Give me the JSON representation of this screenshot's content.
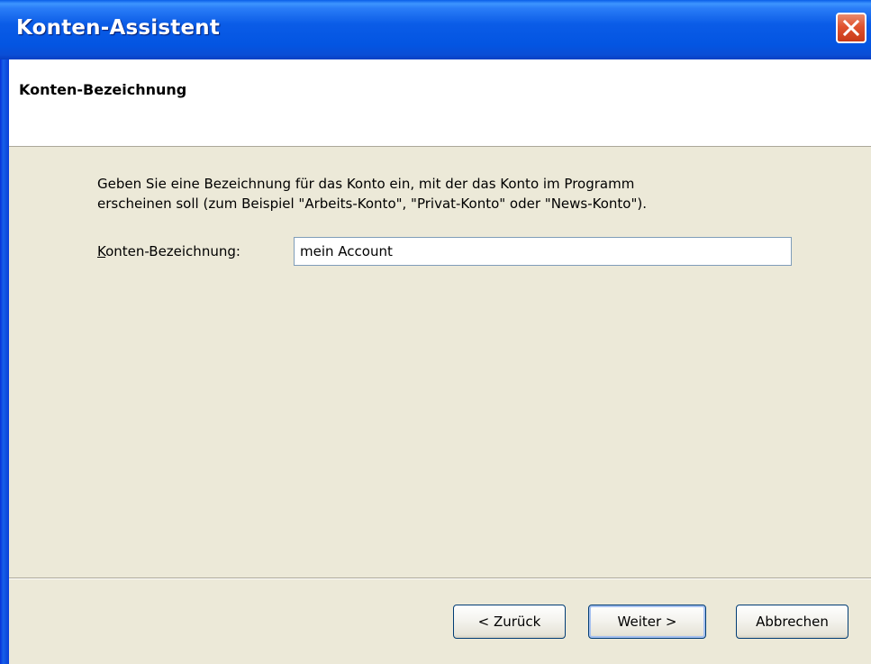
{
  "window": {
    "title": "Konten-Assistent"
  },
  "header": {
    "page_title": "Konten-Bezeichnung"
  },
  "main": {
    "description_line1": "Geben Sie eine Bezeichnung für das Konto ein, mit der das Konto im Programm",
    "description_line2": "erscheinen soll (zum Beispiel \"Arbeits-Konto\", \"Privat-Konto\" oder \"News-Konto\").",
    "field_label_accesskey": "K",
    "field_label_rest": "onten-Bezeichnung:",
    "field_value": "mein Account"
  },
  "buttons": {
    "back_label": "< Zurück",
    "next_label": "Weiter >",
    "cancel_label": "Abbrechen"
  },
  "icons": {
    "close": "close-icon"
  },
  "colors": {
    "titlebar": "#0355e2",
    "close_button": "#e0532f",
    "dialog_background": "#ece9d8",
    "header_background": "#ffffff"
  }
}
